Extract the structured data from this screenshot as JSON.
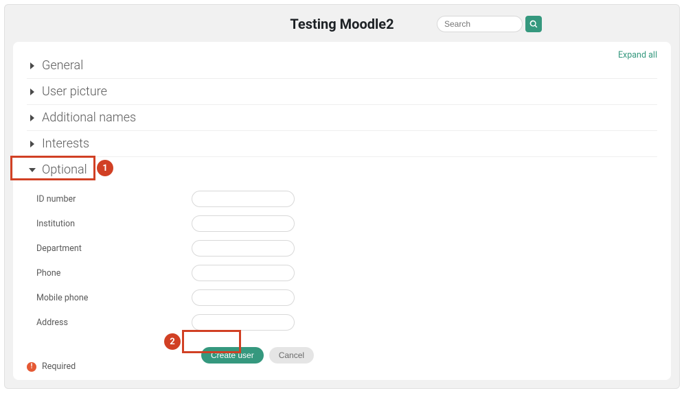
{
  "header": {
    "title": "Testing Moodle2",
    "search_placeholder": "Search"
  },
  "card": {
    "expand_all": "Expand all",
    "required_label": "Required"
  },
  "sections": {
    "general": {
      "title": "General"
    },
    "user_picture": {
      "title": "User picture"
    },
    "additional_names": {
      "title": "Additional names"
    },
    "interests": {
      "title": "Interests"
    },
    "optional": {
      "title": "Optional",
      "fields": {
        "idnumber": {
          "label": "ID number",
          "value": ""
        },
        "institution": {
          "label": "Institution",
          "value": ""
        },
        "department": {
          "label": "Department",
          "value": ""
        },
        "phone": {
          "label": "Phone",
          "value": ""
        },
        "mobile": {
          "label": "Mobile phone",
          "value": ""
        },
        "address": {
          "label": "Address",
          "value": ""
        }
      }
    }
  },
  "actions": {
    "create": "Create user",
    "cancel": "Cancel"
  },
  "annotations": {
    "one": "1",
    "two": "2"
  }
}
